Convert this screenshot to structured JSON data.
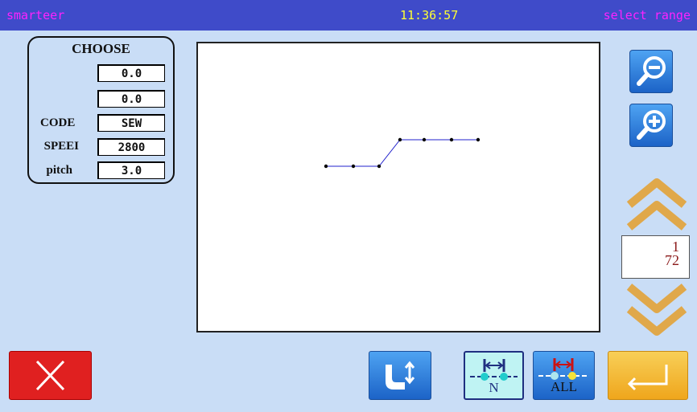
{
  "header": {
    "app_title": "smarteer",
    "time": "11:36:57",
    "mode": "select range"
  },
  "choose_panel": {
    "title": "CHOOSE",
    "rows": [
      {
        "label": "",
        "value": "0.0"
      },
      {
        "label": "",
        "value": "0.0"
      },
      {
        "label": "CODE",
        "value": "SEW"
      },
      {
        "label": "SPEEI",
        "value": "2800"
      },
      {
        "label": "pitch",
        "value": "3.0"
      }
    ]
  },
  "pager": {
    "current": "1",
    "total": "72"
  },
  "buttons": {
    "n_label": "N",
    "all_label": "ALL"
  },
  "icons": {
    "zoom_out": "zoom-out-icon",
    "zoom_in": "zoom-in-icon",
    "page_up": "chevron-up-icon",
    "page_down": "chevron-down-icon",
    "cancel": "close-icon",
    "needle": "needle-updown-icon",
    "enter": "enter-icon"
  },
  "colors": {
    "header_bg": "#3f4bc9",
    "header_accent": "#ff22ff",
    "clock": "#ffff33",
    "panel_bg": "#c9ddf6",
    "cancel_red": "#e02020",
    "enter_yellow": "#f3b62a",
    "chevron_gold": "#e0a84a",
    "stitch_line": "#2222cc"
  }
}
